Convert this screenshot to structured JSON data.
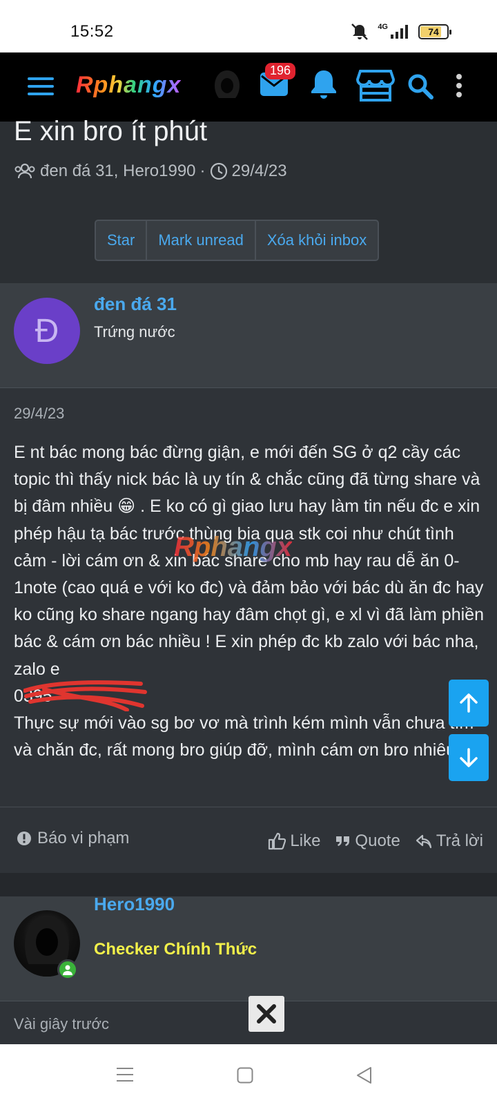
{
  "status_bar": {
    "time": "15:52",
    "network": "4G",
    "battery": "74",
    "battery_level": 0.74
  },
  "header": {
    "logo_text": "Rphangx",
    "notification_count": "196"
  },
  "thread": {
    "title": "E xin bro ít phút",
    "participants": "đen đá 31, Hero1990",
    "separator": "·",
    "date": "29/4/23",
    "buttons": [
      "Star",
      "Mark unread",
      "Xóa khỏi inbox"
    ]
  },
  "post1": {
    "avatar_letter": "Đ",
    "username": "đen đá 31",
    "user_title": "Trứng nước",
    "date": "29/4/23",
    "message_part1": "E nt bác mong bác đừng giận, e mới đến SG ở q2 cầy các topic thì thấy nick bác là uy tín & chắc cũng đã từng share và bị đâm nhiều",
    "emoji": "😁",
    "message_part2": ". E ko có gì giao lưu hay làm tin nếu đc e xin phép hậu tạ bác trước thùng bia qua stk coi như chút tình cảm - lời cám ơn & xin bác share cho mb hay rau dễ ăn 0-1note (cao quá e với ko đc) và đảm bảo với bác dù ăn đc hay ko cũng ko share ngang hay đâm chọt gì, e xl vì đã làm phiền bác & cám ơn bác nhiều ! E xin phép đc kb zalo với bác nha, zalo e",
    "phone_partial": "0395",
    "message_part3": "Thực sự mới vào sg bơ vơ mà trình kém mình vẫn chưa tìm và chăn đc, rất mong bro giúp đỡ, mình cám ơn bro nhiêu!",
    "watermark": "Rphangx",
    "report_label": "Báo vi phạm",
    "like_label": "Like",
    "quote_label": "Quote",
    "reply_label": "Trả lời"
  },
  "post2": {
    "username": "Hero1990",
    "user_title": "Checker Chính Thức",
    "time": "Vài giây trước"
  },
  "colors": {
    "accent": "#4aa9ee",
    "rank": "#f2f04a",
    "fab": "#1aa3f0",
    "badge": "#e0232f"
  }
}
